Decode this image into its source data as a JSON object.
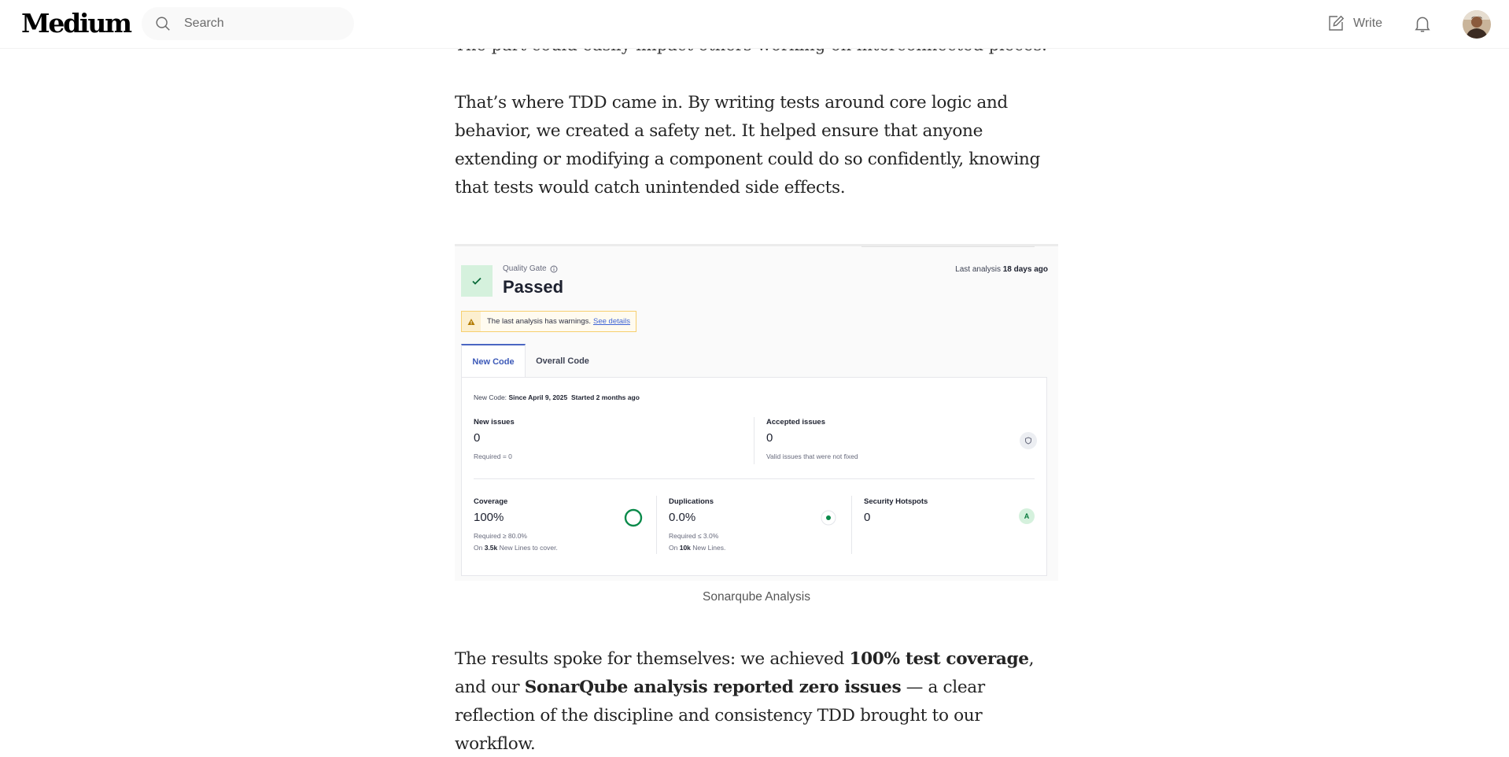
{
  "header": {
    "logo": "Medium",
    "search": {
      "placeholder": "Search"
    },
    "write_label": "Write"
  },
  "article": {
    "top_partial_text": "The part could easily impact others working on interconnected pieces.",
    "para1": "That’s where TDD came in. By writing tests around core logic and behavior, we created a safety net. It helped ensure that anyone extending or modifying a component could do so confidently, knowing that tests would catch unintended side effects.",
    "figure": {
      "quality_gate_label": "Quality Gate",
      "status": "Passed",
      "last_analysis_prefix": "Last analysis",
      "last_analysis_value": "18 days ago",
      "warning_text": "The last analysis has warnings.",
      "warning_link": "See details",
      "tabs": [
        "New Code",
        "Overall Code"
      ],
      "new_code_prefix": "New Code:",
      "new_code_since": "Since April 9, 2025",
      "new_code_started": "Started 2 months ago",
      "new_issues": {
        "title": "New issues",
        "value": "0",
        "sub": "Required = 0"
      },
      "accepted_issues": {
        "title": "Accepted issues",
        "value": "0",
        "sub": "Valid issues that were not fixed"
      },
      "coverage": {
        "title": "Coverage",
        "value": "100%",
        "required": "Required ≥ 80.0%",
        "on_prefix": "On",
        "on_value": "3.5k",
        "on_suffix": "New Lines to cover.",
        "fraction": 1.0
      },
      "duplications": {
        "title": "Duplications",
        "value": "0.0%",
        "required": "Required ≤ 3.0%",
        "on_prefix": "On",
        "on_value": "10k",
        "on_suffix": "New Lines."
      },
      "security_hotspots": {
        "title": "Security Hotspots",
        "value": "0",
        "rating": "A"
      },
      "colors": {
        "passed_green": "#0a8a4a",
        "accent_blue": "#3c59b8"
      }
    },
    "caption": "Sonarqube Analysis",
    "para2": {
      "t1": "The results spoke for themselves: we achieved ",
      "b1": "100% test coverage",
      "t2": ", and our ",
      "b2": "SonarQube analysis reported zero issues",
      "t3": " — a clear reflection of the discipline and consistency TDD brought to our workflow."
    }
  }
}
